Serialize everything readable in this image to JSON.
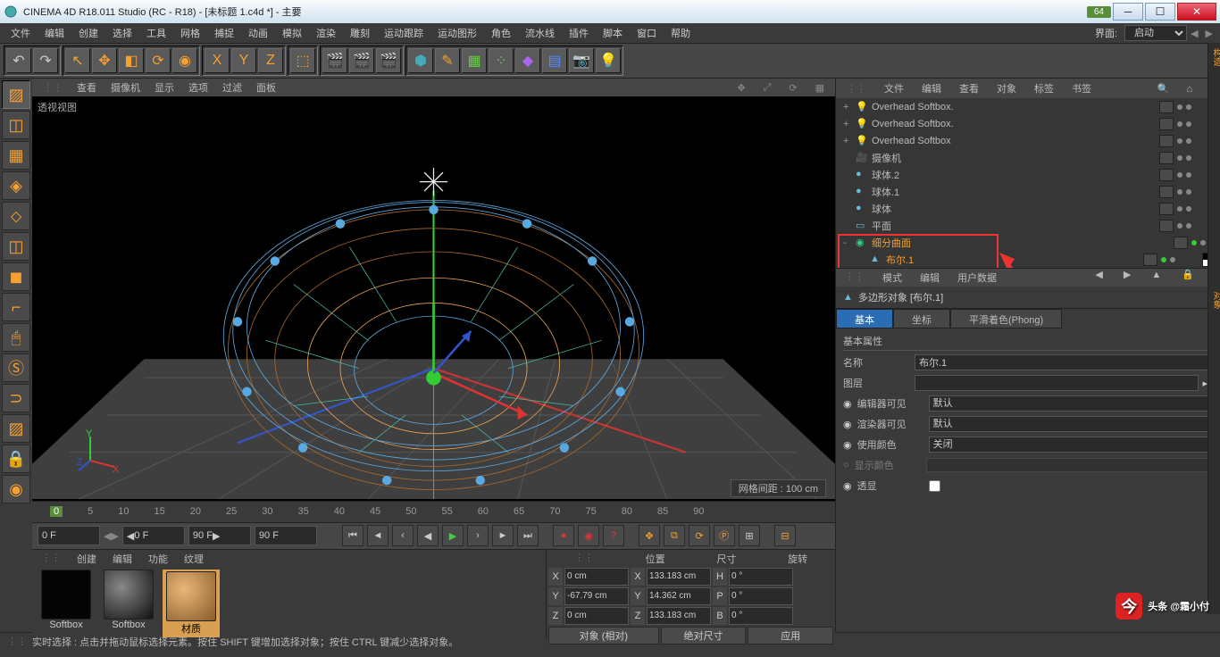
{
  "title": "CINEMA 4D R18.011 Studio (RC - R18) - [未标题 1.c4d *] - 主要",
  "title_badge": "64",
  "menu": [
    "文件",
    "编辑",
    "创建",
    "选择",
    "工具",
    "网格",
    "捕捉",
    "动画",
    "模拟",
    "渲染",
    "雕刻",
    "运动跟踪",
    "运动图形",
    "角色",
    "流水线",
    "插件",
    "脚本",
    "窗口",
    "帮助"
  ],
  "menu_right": {
    "label": "界面:",
    "value": "启动"
  },
  "vp_menu": [
    "查看",
    "摄像机",
    "显示",
    "选项",
    "过滤",
    "面板"
  ],
  "vp_label": "透视视图",
  "vp_grid": "网格间距 : 100 cm",
  "timeline": {
    "start": "0",
    "marks": [
      "0",
      "5",
      "10",
      "15",
      "20",
      "25",
      "30",
      "35",
      "40",
      "45",
      "50",
      "55",
      "60",
      "65",
      "70",
      "75",
      "80",
      "85",
      "90"
    ]
  },
  "playback": {
    "cur": "0 F",
    "from": "0 F",
    "fromEnd": "90 F",
    "to": "90 F"
  },
  "mat_menu": [
    "创建",
    "编辑",
    "功能",
    "纹理"
  ],
  "materials": [
    {
      "name": "Softbox",
      "type": "black"
    },
    {
      "name": "Softbox",
      "type": "dark"
    },
    {
      "name": "材质",
      "type": "wood",
      "sel": true
    }
  ],
  "coords": {
    "headers": [
      "位置",
      "尺寸",
      "旋转"
    ],
    "rows": [
      {
        "axis": "X",
        "pos": "0 cm",
        "size": "133.183 cm",
        "rot": "H",
        "rotv": "0 °"
      },
      {
        "axis": "Y",
        "pos": "-67.79 cm",
        "size": "14.362 cm",
        "rot": "P",
        "rotv": "0 °"
      },
      {
        "axis": "Z",
        "pos": "0 cm",
        "size": "133.183 cm",
        "rot": "B",
        "rotv": "0 °"
      }
    ],
    "btns": [
      "对象 (相对)",
      "绝对尺寸",
      "应用"
    ]
  },
  "obj_tabs": [
    "文件",
    "编辑",
    "查看",
    "对象",
    "标签",
    "书签"
  ],
  "tree": [
    {
      "indent": 0,
      "exp": "+",
      "icon": "light",
      "name": "Overhead Softbox."
    },
    {
      "indent": 0,
      "exp": "+",
      "icon": "light",
      "name": "Overhead Softbox."
    },
    {
      "indent": 0,
      "exp": "+",
      "icon": "light",
      "name": "Overhead Softbox"
    },
    {
      "indent": 0,
      "exp": "",
      "icon": "cam",
      "name": "摄像机"
    },
    {
      "indent": 0,
      "exp": "",
      "icon": "sphere",
      "name": "球体.2"
    },
    {
      "indent": 0,
      "exp": "",
      "icon": "sphere",
      "name": "球体.1"
    },
    {
      "indent": 0,
      "exp": "",
      "icon": "sphere",
      "name": "球体"
    },
    {
      "indent": 0,
      "exp": "",
      "icon": "plane",
      "name": "平面"
    },
    {
      "indent": 0,
      "exp": "-",
      "icon": "subdiv",
      "name": "细分曲面",
      "hl": true
    },
    {
      "indent": 1,
      "exp": "",
      "icon": "poly",
      "name": "布尔.1",
      "hl": true
    }
  ],
  "attr_tabs": [
    "模式",
    "编辑",
    "用户数据"
  ],
  "attr_obj_label": "多边形对象 [布尔.1]",
  "sub_tabs": [
    "基本",
    "坐标",
    "平滑着色(Phong)"
  ],
  "attr_section": "基本属性",
  "attrs": {
    "name_label": "名称",
    "name_value": "布尔.1",
    "layer_label": "图层",
    "layer_value": "",
    "editor_label": "编辑器可见",
    "editor_value": "默认",
    "render_label": "渲染器可见",
    "render_value": "默认",
    "usecolor_label": "使用颜色",
    "usecolor_value": "关闭",
    "dispcolor_label": "显示颜色",
    "xray_label": "透显"
  },
  "statusbar": "实时选择 : 点击并拖动鼠标选择元素。按住 SHIFT 键增加选择对象；按住 CTRL 键减少选择对象。",
  "watermark": "头条 @霜小付",
  "rstrip": [
    "构造",
    "对象"
  ]
}
